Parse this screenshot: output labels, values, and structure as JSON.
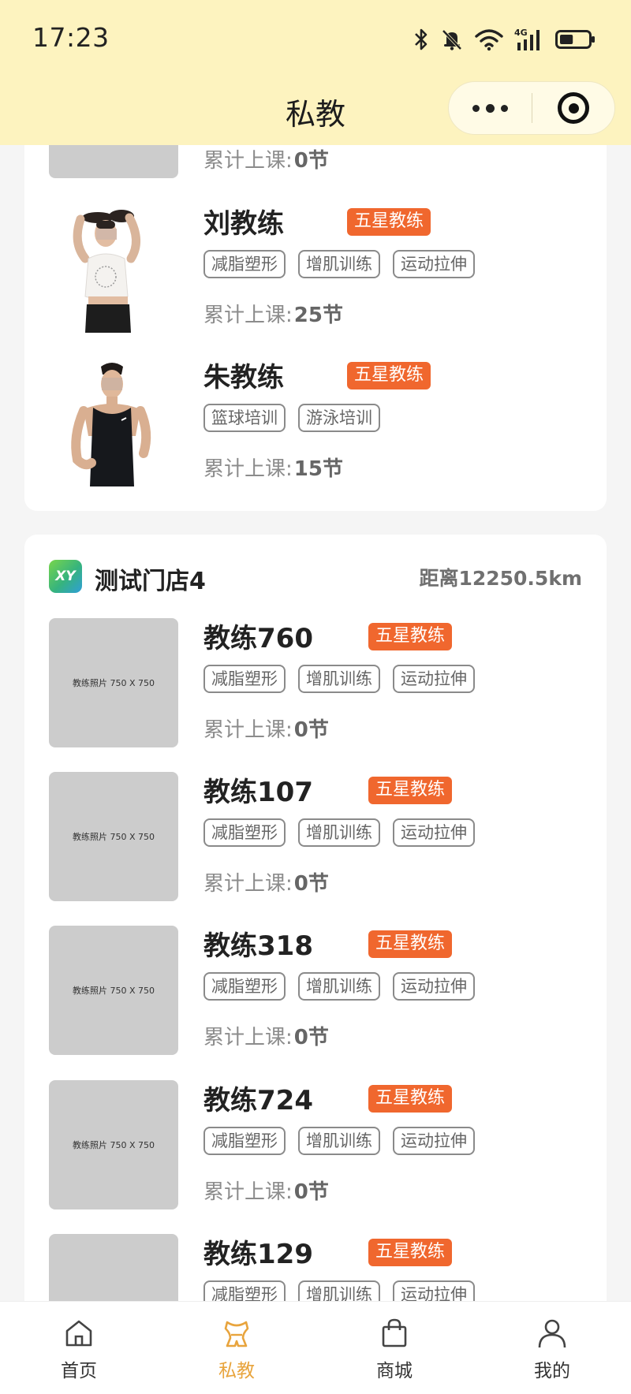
{
  "status_bar": {
    "time": "17:23",
    "battery": 0.45
  },
  "header": {
    "title": "私教"
  },
  "store1": {
    "coaches": [
      {
        "name": "",
        "badge": "",
        "tags": [],
        "lessons_label": "累计上课:",
        "lessons_value": "0节"
      },
      {
        "name": "刘教练",
        "badge": "五星教练",
        "tags": [
          "减脂塑形",
          "增肌训练",
          "运动拉伸"
        ],
        "lessons_label": "累计上课:",
        "lessons_value": "25节"
      },
      {
        "name": "朱教练",
        "badge": "五星教练",
        "tags": [
          "篮球培训",
          "游泳培训"
        ],
        "lessons_label": "累计上课:",
        "lessons_value": "15节"
      }
    ]
  },
  "store2": {
    "logo_text": "XY",
    "name": "测试门店4",
    "distance": "距离12250.5km",
    "photo_placeholder": "教练照片 750 X 750",
    "coaches": [
      {
        "name": "教练760",
        "badge": "五星教练",
        "tags": [
          "减脂塑形",
          "增肌训练",
          "运动拉伸"
        ],
        "lessons_label": "累计上课:",
        "lessons_value": "0节"
      },
      {
        "name": "教练107",
        "badge": "五星教练",
        "tags": [
          "减脂塑形",
          "增肌训练",
          "运动拉伸"
        ],
        "lessons_label": "累计上课:",
        "lessons_value": "0节"
      },
      {
        "name": "教练318",
        "badge": "五星教练",
        "tags": [
          "减脂塑形",
          "增肌训练",
          "运动拉伸"
        ],
        "lessons_label": "累计上课:",
        "lessons_value": "0节"
      },
      {
        "name": "教练724",
        "badge": "五星教练",
        "tags": [
          "减脂塑形",
          "增肌训练",
          "运动拉伸"
        ],
        "lessons_label": "累计上课:",
        "lessons_value": "0节"
      },
      {
        "name": "教练129",
        "badge": "五星教练",
        "tags": [
          "减脂塑形",
          "增肌训练",
          "运动拉伸"
        ],
        "lessons_label": "",
        "lessons_value": ""
      }
    ]
  },
  "tabbar": {
    "items": [
      {
        "label": "首页",
        "icon": "home-icon"
      },
      {
        "label": "私教",
        "icon": "coach-icon"
      },
      {
        "label": "商城",
        "icon": "shopping-bag-icon"
      },
      {
        "label": "我的",
        "icon": "profile-icon"
      }
    ],
    "active_index": 1
  },
  "colors": {
    "header_bg": "#fdf3bf",
    "badge": "#f0672e",
    "active_tab": "#e8a43d"
  }
}
